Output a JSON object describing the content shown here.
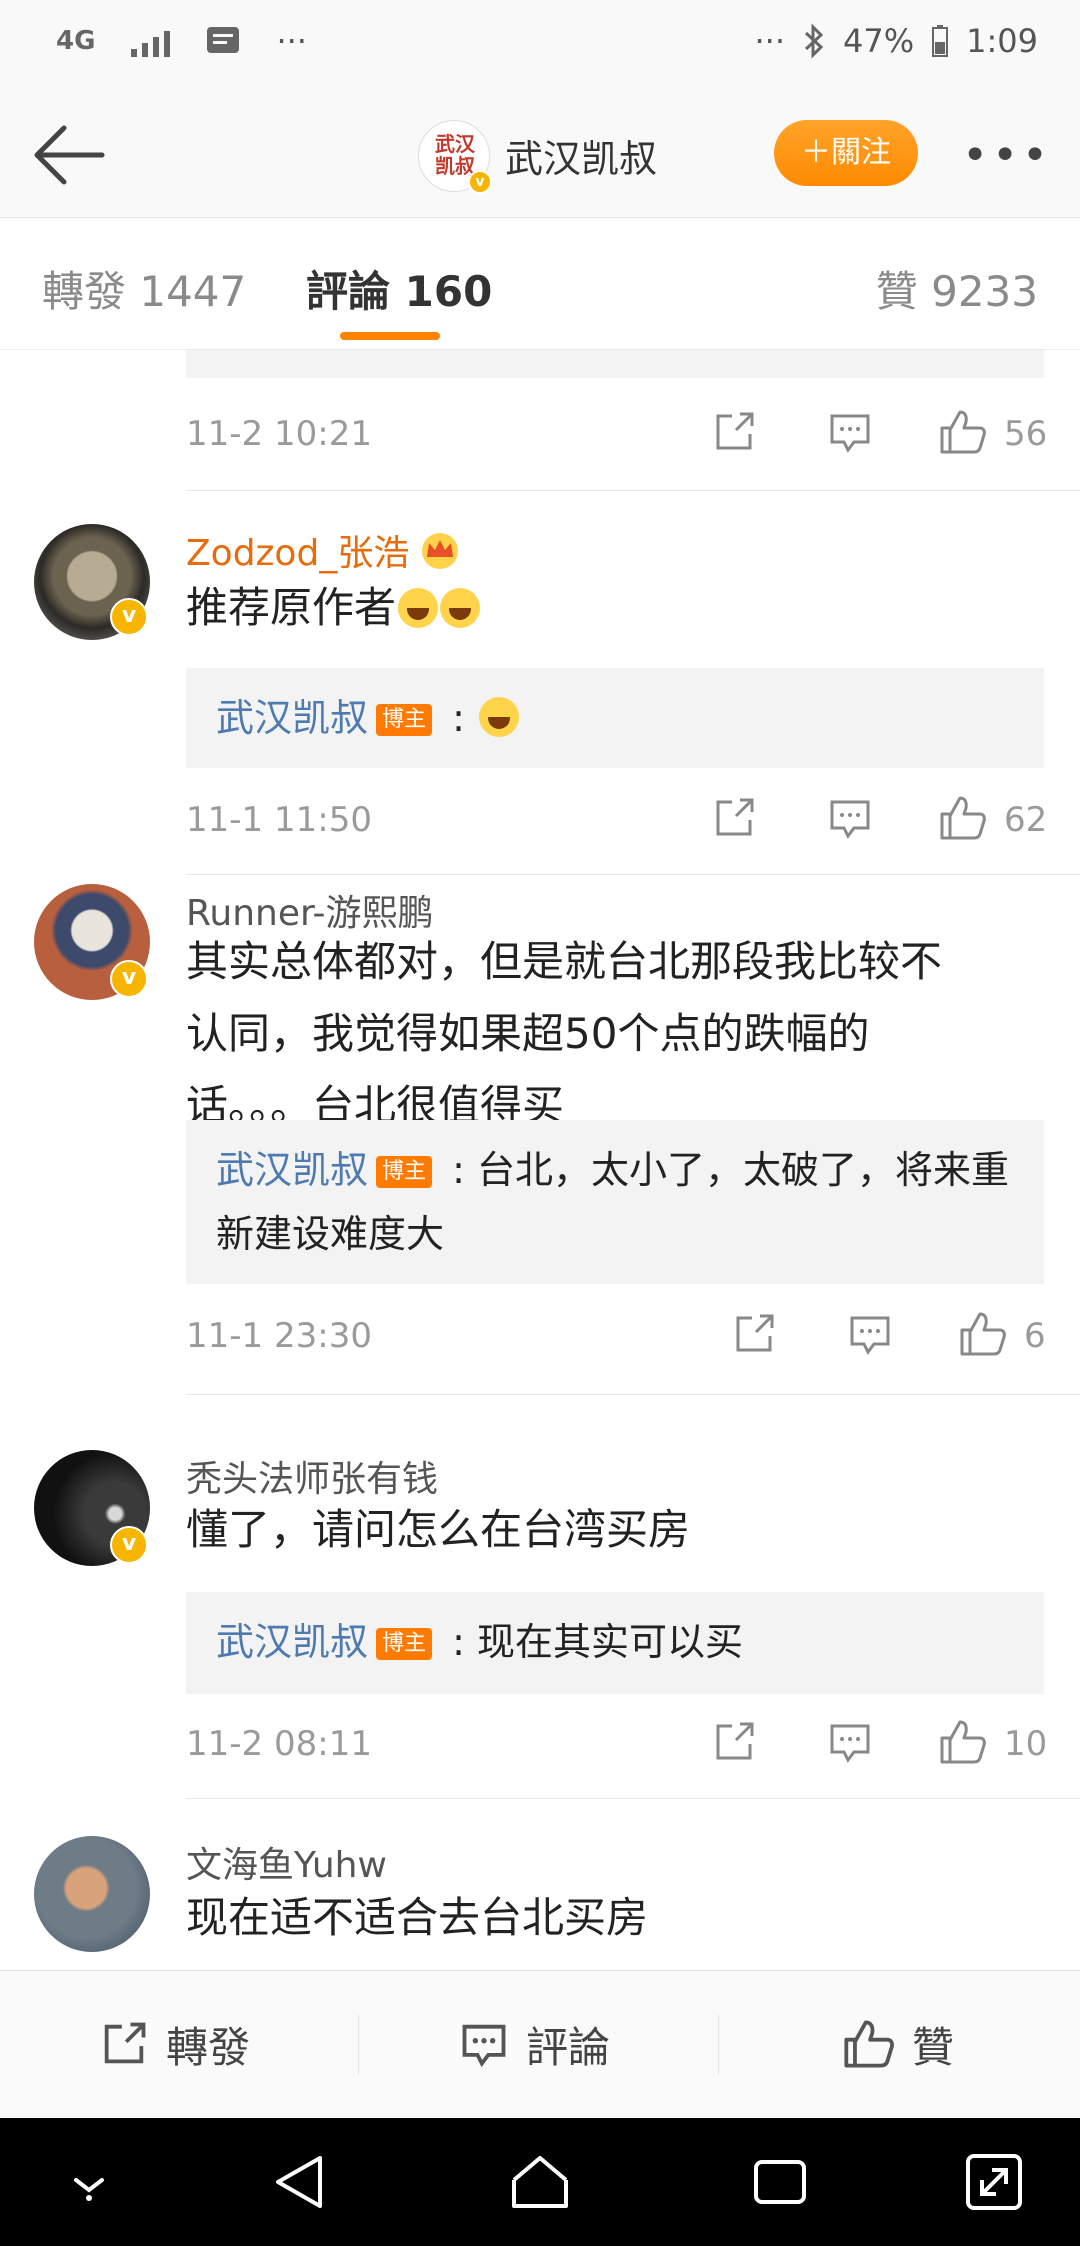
{
  "status_bar": {
    "network": "4G",
    "dots_left": "···",
    "dots_right": "···",
    "battery": "47%",
    "time": "1:09"
  },
  "header": {
    "avatar_lines": [
      "武汉",
      "凯叔"
    ],
    "title": "武汉凯叔",
    "follow": "＋關注",
    "more": "•••"
  },
  "tabs": {
    "repost": "轉發 1447",
    "comments": "評論 160",
    "likes": "贊 9233"
  },
  "comments": [
    {
      "time": "11-2 10:21",
      "likes": "56"
    },
    {
      "name": "Zodzod_张浩",
      "text": "推荐原作者",
      "reply_name": "武汉凯叔",
      "reply_tag": "博主",
      "reply_text": " : ",
      "time": "11-1 11:50",
      "likes": "62"
    },
    {
      "name": "Runner-游熙鹏",
      "text": "其实总体都对，但是就台北那段我比较不认同，我觉得如果超50个点的跌幅的话。。。台北很值得买",
      "reply_name": "武汉凯叔",
      "reply_tag": "博主",
      "reply_text": " : 台北，太小了，太破了，将来重新建设难度大",
      "time": "11-1 23:30",
      "likes": "6"
    },
    {
      "name": "秃头法师张有钱",
      "text": "懂了，请问怎么在台湾买房",
      "reply_name": "武汉凯叔",
      "reply_tag": "博主",
      "reply_text": " : 现在其实可以买",
      "time": "11-2 08:11",
      "likes": "10"
    },
    {
      "name": "文海鱼Yuhw",
      "text": "现在适不适合去台北买房"
    }
  ],
  "bottom_bar": {
    "repost": "轉發",
    "comment": "評論",
    "like": "贊"
  },
  "colors": {
    "accent": "#ff8200",
    "link": "#4d7bb0",
    "vip_name": "#e86b0c"
  }
}
